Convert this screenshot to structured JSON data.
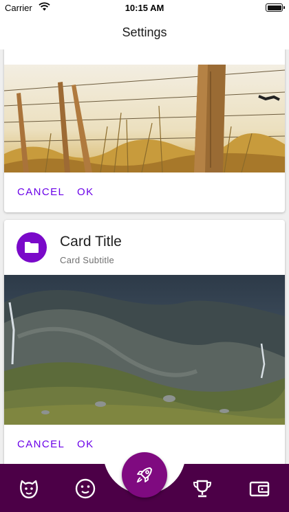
{
  "status_bar": {
    "carrier": "Carrier",
    "time": "10:15 AM"
  },
  "app_bar": {
    "title": "Settings"
  },
  "cards": [
    {
      "image": "fence-photo",
      "cancel_label": "CANCEL",
      "ok_label": "OK"
    },
    {
      "icon": "folder-icon",
      "title": "Card Title",
      "subtitle": "Card Subtitle",
      "image": "mountain-photo",
      "cancel_label": "CANCEL",
      "ok_label": "OK"
    }
  ],
  "bottom_nav": {
    "items": [
      "face-happy-icon",
      "smiley-icon",
      "rocket-icon",
      "trophy-icon",
      "wallet-icon"
    ],
    "active": "rocket-icon"
  },
  "colors": {
    "accent": "#6a00e8",
    "nav_background": "#4c0047",
    "fab": "#7f0a80",
    "avatar": "#7a09c9"
  }
}
